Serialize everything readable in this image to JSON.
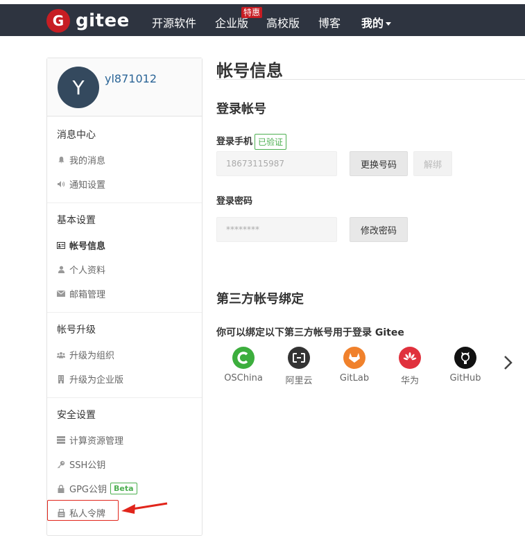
{
  "nav": {
    "logo_mark": "G",
    "logo_text": "gitee",
    "items": [
      "开源软件",
      "企业版",
      "高校版",
      "博客",
      "我的"
    ],
    "badge": "特惠"
  },
  "user": {
    "avatar_letter": "Y",
    "username": "yl871012"
  },
  "sidebar": {
    "groups": [
      {
        "title": "消息中心",
        "items": [
          "我的消息",
          "通知设置"
        ]
      },
      {
        "title": "基本设置",
        "items": [
          "帐号信息",
          "个人资料",
          "邮箱管理"
        ]
      },
      {
        "title": "帐号升级",
        "items": [
          "升级为组织",
          "升级为企业版"
        ]
      },
      {
        "title": "安全设置",
        "items": [
          "计算资源管理",
          "SSH公钥",
          "GPG公钥",
          "私人令牌"
        ]
      }
    ],
    "beta_label": "Beta",
    "active_item": "帐号信息"
  },
  "main": {
    "title": "帐号信息",
    "login_section": "登录帐号",
    "phone_label": "登录手机",
    "verified_label": "已验证",
    "phone_value": "18673115987",
    "change_number_button": "更换号码",
    "unbind_button": "解绑",
    "password_label": "登录密码",
    "password_value": "********",
    "change_password_button": "修改密码",
    "third_party_section": "第三方帐号绑定",
    "bind_hint": "你可以绑定以下第三方帐号用于登录 Gitee",
    "providers": [
      {
        "name": "OSChina",
        "color": "#3cae3d"
      },
      {
        "name": "阿里云",
        "color": "#333333"
      },
      {
        "name": "GitLab",
        "color": "#f0812c"
      },
      {
        "name": "华为",
        "color": "#e0313d"
      },
      {
        "name": "GitHub",
        "color": "#111111"
      }
    ]
  },
  "colors": {
    "navbar": "#2e3440",
    "brand_red": "#c71d23",
    "link_blue": "#2a6496",
    "verified_green": "#4caf50",
    "highlight_red": "#e1251b"
  }
}
